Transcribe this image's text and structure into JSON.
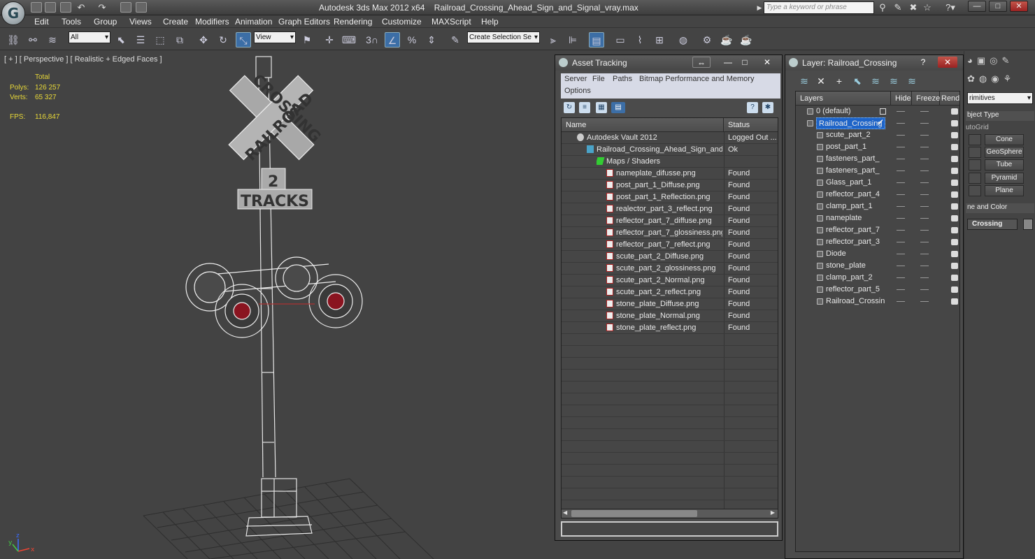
{
  "titlebar": {
    "app": "Autodesk 3ds Max  2012 x64",
    "file": "Railroad_Crossing_Ahead_Sign_and_Signal_vray.max",
    "search_placeholder": "Type a keyword or phrase",
    "logo_glyph": "G"
  },
  "menus": [
    "Edit",
    "Tools",
    "Group",
    "Views",
    "Create",
    "Modifiers",
    "Animation",
    "Graph Editors",
    "Rendering",
    "Customize",
    "MAXScript",
    "Help"
  ],
  "toolbar": {
    "filter": "All",
    "ref_coord": "View",
    "snap_label": "3",
    "selection_set": "Create Selection Se"
  },
  "viewport": {
    "label": "[ + ] [ Perspective ] [ Realistic + Edged Faces ]",
    "stats_header": "Total",
    "polys_label": "Polys:",
    "polys_value": "126 257",
    "verts_label": "Verts:",
    "verts_value": "65 327",
    "fps_label": "FPS:",
    "fps_value": "116,847",
    "sign_top": "CROSSING",
    "sign_bottom": "RAILROAD",
    "tracks_number": "2",
    "tracks_label": "TRACKS",
    "axis_x": "x",
    "axis_y": "y",
    "axis_z": "z"
  },
  "asset_tracking": {
    "title": "Asset Tracking",
    "menu": [
      "Server",
      "File",
      "Paths",
      "Bitmap Performance and Memory",
      "Options"
    ],
    "col_name": "Name",
    "col_status": "Status",
    "rows": [
      {
        "name": "Autodesk Vault 2012",
        "status": "Logged Out ...",
        "level": 1,
        "icon": "vault"
      },
      {
        "name": "Railroad_Crossing_Ahead_Sign_and_...",
        "status": "Ok",
        "level": 2,
        "icon": "max"
      },
      {
        "name": "Maps / Shaders",
        "status": "",
        "level": 3,
        "icon": "maps"
      },
      {
        "name": "nameplate_difusse.png",
        "status": "Found",
        "level": 4,
        "icon": "file"
      },
      {
        "name": "post_part_1_Diffuse.png",
        "status": "Found",
        "level": 4,
        "icon": "file"
      },
      {
        "name": "post_part_1_Reflection.png",
        "status": "Found",
        "level": 4,
        "icon": "file"
      },
      {
        "name": "realector_part_3_reflect.png",
        "status": "Found",
        "level": 4,
        "icon": "file"
      },
      {
        "name": "reflector_part_7_diffuse.png",
        "status": "Found",
        "level": 4,
        "icon": "file"
      },
      {
        "name": "reflector_part_7_glossiness.png",
        "status": "Found",
        "level": 4,
        "icon": "file"
      },
      {
        "name": "reflector_part_7_reflect.png",
        "status": "Found",
        "level": 4,
        "icon": "file"
      },
      {
        "name": "scute_part_2_Diffuse.png",
        "status": "Found",
        "level": 4,
        "icon": "file"
      },
      {
        "name": "scute_part_2_glossiness.png",
        "status": "Found",
        "level": 4,
        "icon": "file"
      },
      {
        "name": "scute_part_2_Normal.png",
        "status": "Found",
        "level": 4,
        "icon": "file"
      },
      {
        "name": "scute_part_2_reflect.png",
        "status": "Found",
        "level": 4,
        "icon": "file"
      },
      {
        "name": "stone_plate_Diffuse.png",
        "status": "Found",
        "level": 4,
        "icon": "file"
      },
      {
        "name": "stone_plate_Normal.png",
        "status": "Found",
        "level": 4,
        "icon": "file"
      },
      {
        "name": "stone_plate_reflect.png",
        "status": "Found",
        "level": 4,
        "icon": "file"
      }
    ],
    "empty_rows": 16
  },
  "layer_window": {
    "title": "Layer: Railroad_Crossing",
    "col_layers": "Layers",
    "col_hide": "Hide",
    "col_freeze": "Freeze",
    "col_render": "Rende",
    "rows": [
      {
        "name": "0 (default)",
        "level": 0,
        "selected": false
      },
      {
        "name": "Railroad_Crossing",
        "level": 0,
        "selected": true
      },
      {
        "name": "scute_part_2",
        "level": 1,
        "selected": false
      },
      {
        "name": "post_part_1",
        "level": 1,
        "selected": false
      },
      {
        "name": "fasteners_part_",
        "level": 1,
        "selected": false
      },
      {
        "name": "fasteners_part_",
        "level": 1,
        "selected": false
      },
      {
        "name": "Glass_part_1",
        "level": 1,
        "selected": false
      },
      {
        "name": "reflector_part_4",
        "level": 1,
        "selected": false
      },
      {
        "name": "clamp_part_1",
        "level": 1,
        "selected": false
      },
      {
        "name": "nameplate",
        "level": 1,
        "selected": false
      },
      {
        "name": "reflector_part_7",
        "level": 1,
        "selected": false
      },
      {
        "name": "reflector_part_3",
        "level": 1,
        "selected": false
      },
      {
        "name": "Diode",
        "level": 1,
        "selected": false
      },
      {
        "name": "stone_plate",
        "level": 1,
        "selected": false
      },
      {
        "name": "clamp_part_2",
        "level": 1,
        "selected": false
      },
      {
        "name": "reflector_part_5",
        "level": 1,
        "selected": false
      },
      {
        "name": "Railroad_Crossin",
        "level": 1,
        "selected": false
      }
    ]
  },
  "command_panel": {
    "dropdown": "rimitives",
    "object_type": "bject Type",
    "autogrid": "utoGrid",
    "buttons": [
      "Cone",
      "GeoSphere",
      "Tube",
      "Pyramid",
      "Plane"
    ],
    "name_color": "ne and Color",
    "name_value": "Crossing"
  },
  "colors": {
    "accent": "#3c6ea6",
    "selection": "#1e64c8",
    "stats": "#e8d838",
    "light_red": "#8a1420"
  }
}
